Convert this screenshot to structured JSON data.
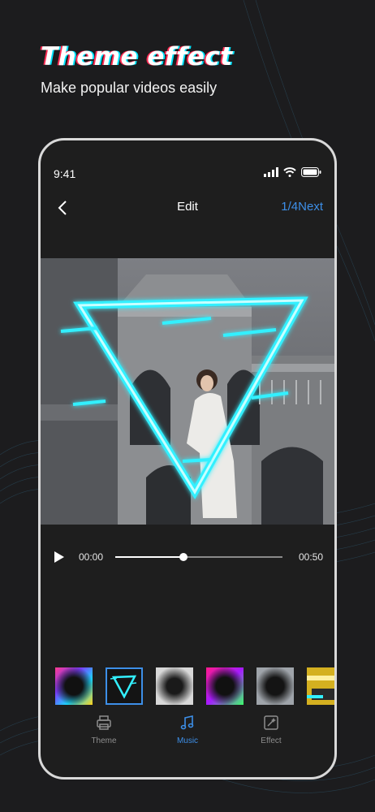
{
  "promo": {
    "headline": "Theme effect",
    "subline": "Make popular videos easily"
  },
  "status_bar": {
    "time": "9:41",
    "icons": [
      "signal-icon",
      "wifi-icon",
      "battery-icon"
    ]
  },
  "nav": {
    "back_icon": "chevron-left-icon",
    "title": "Edit",
    "next_label": "1/4Next"
  },
  "player": {
    "current_time": "00:00",
    "total_time": "00:50",
    "progress": 0.41,
    "play_icon": "play-icon"
  },
  "effect_thumbnails": [
    {
      "name": "rainbow-vignette",
      "selected": false
    },
    {
      "name": "neon-triangle",
      "selected": true
    },
    {
      "name": "white-glow-vignette",
      "selected": false
    },
    {
      "name": "magenta-green-vignette",
      "selected": false
    },
    {
      "name": "silver-vignette",
      "selected": false
    },
    {
      "name": "gold-glitch",
      "selected": false
    }
  ],
  "tabs": [
    {
      "label": "Theme",
      "icon": "printer-icon",
      "active": false
    },
    {
      "label": "Music",
      "icon": "music-note-icon",
      "active": true
    },
    {
      "label": "Effect",
      "icon": "magic-wand-icon",
      "active": false
    }
  ],
  "colors": {
    "accent": "#3d8fe8",
    "background": "#1c1c1e",
    "phone_bezel": "#d9d9d9",
    "neon": "#33f0ff"
  }
}
